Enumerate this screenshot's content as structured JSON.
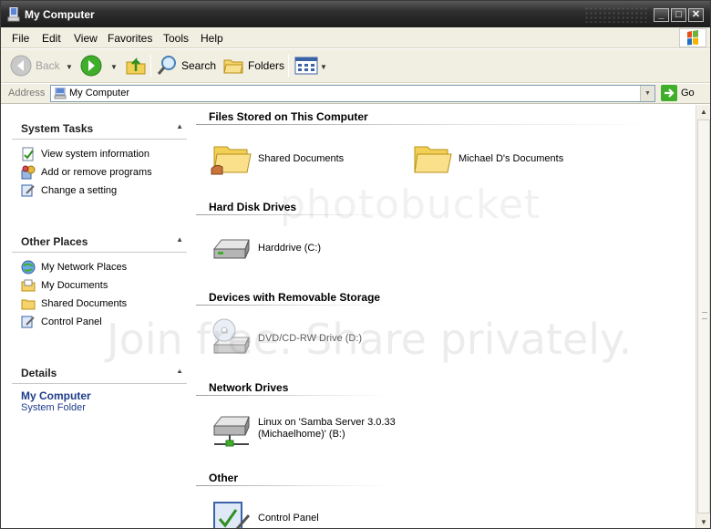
{
  "window": {
    "title": "My Computer"
  },
  "menu": [
    "File",
    "Edit",
    "View",
    "Favorites",
    "Tools",
    "Help"
  ],
  "toolbar": {
    "back": "Back",
    "search": "Search",
    "folders": "Folders"
  },
  "address": {
    "label": "Address",
    "value": "My Computer",
    "go": "Go"
  },
  "taskpane": {
    "system_tasks": {
      "title": "System Tasks",
      "items": [
        "View system information",
        "Add or remove programs",
        "Change a setting"
      ]
    },
    "other_places": {
      "title": "Other Places",
      "items": [
        "My Network Places",
        "My Documents",
        "Shared Documents",
        "Control Panel"
      ]
    },
    "details": {
      "title": "Details",
      "name": "My Computer",
      "type": "System Folder"
    }
  },
  "content": {
    "files": {
      "title": "Files Stored on This Computer",
      "items": [
        "Shared Documents",
        "Michael D's Documents"
      ]
    },
    "hdd": {
      "title": "Hard Disk Drives",
      "items": [
        "Harddrive (C:)"
      ]
    },
    "removable": {
      "title": "Devices with Removable Storage",
      "items": [
        "DVD/CD-RW Drive (D:)"
      ]
    },
    "network": {
      "title": "Network Drives",
      "item_line1": "Linux on 'Samba Server 3.0.33",
      "item_line2": "(Michaelhome)' (B:)"
    },
    "other": {
      "title": "Other",
      "items": [
        "Control Panel"
      ]
    }
  },
  "watermark": {
    "brand": "photobucket",
    "slogan": "Join free. Share privately."
  },
  "colors": {
    "titlebar": "#2e2e2e",
    "chrome": "#f1efe2",
    "details_blue": "#1f3c8a"
  }
}
